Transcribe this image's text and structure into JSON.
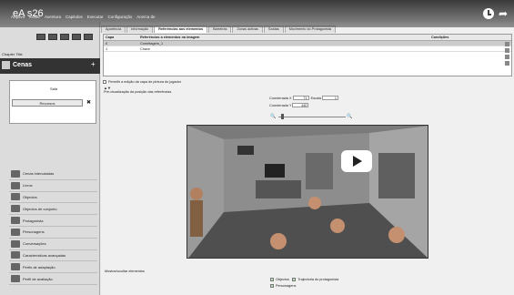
{
  "video": {
    "title": "eA s26"
  },
  "menu": [
    "Arquivo",
    "Editar",
    "Aventura",
    "Capitulos",
    "Executar",
    "Configuração",
    "Acerca de"
  ],
  "left": {
    "chapter_title": "Chapter Title",
    "section": "Cenas",
    "scene_name": "Sala",
    "scene_button": "Recursos",
    "nav": [
      "Cenas intercaladas",
      "Livros",
      "Objectos",
      "Objectos de conjunto",
      "Protagonista",
      "Personagens",
      "Conversações",
      "Características avançadas",
      "Perfis de adaptação",
      "Perfil de avaliação"
    ]
  },
  "right": {
    "tabs": [
      "Aparência",
      "Informação",
      "Referências aos elementos",
      "Barreiras",
      "Zonas activas",
      "Saídas",
      "Movimento do Protagonista"
    ],
    "table": {
      "headers": [
        "Capa",
        "",
        "Referências a elementos na imagem",
        "Condições"
      ],
      "rows": [
        [
          "0",
          "Cornetagem_1"
        ],
        [
          "1",
          "Chave"
        ]
      ]
    },
    "checkbox_label": "Permitir a edição da capa de pintura do jogador",
    "preview_label": "Pré-visualização da posição das referências",
    "coord_x_label": "Coordenada X",
    "coord_x": "71",
    "coord_y_label": "Coordenada Y",
    "coord_y": "440",
    "scale_label": "Escala",
    "scale": "1",
    "show_label": "Mostrar/ocultar elementos",
    "options": [
      "Objectos",
      "Trajectoria do protagonista",
      "Personagens"
    ]
  }
}
